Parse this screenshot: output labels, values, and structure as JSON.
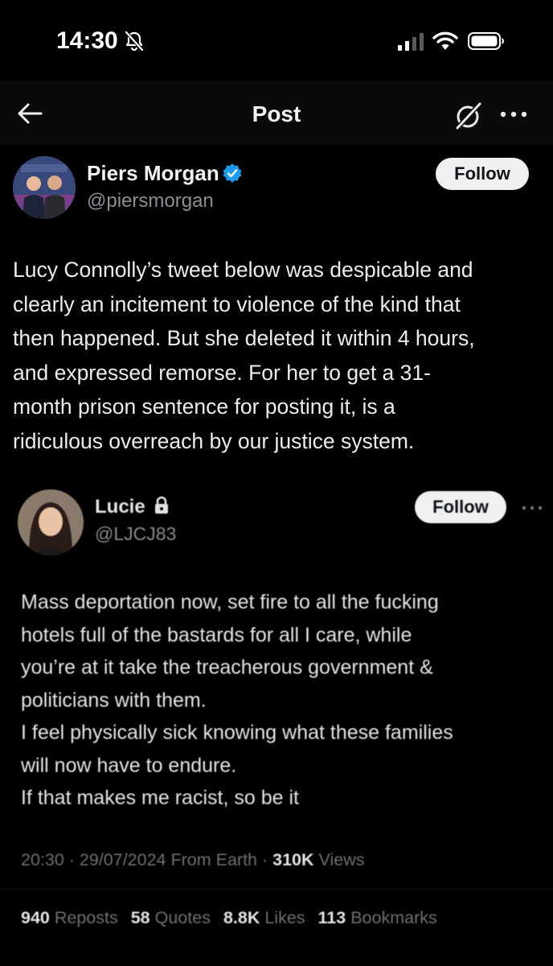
{
  "status_bar": {
    "time": "14:30",
    "icons": [
      "bell-slash-icon",
      "cellular-signal-icon",
      "wifi-icon",
      "battery-icon"
    ]
  },
  "nav": {
    "title": "Post",
    "icons": [
      "back-arrow-icon",
      "grok-icon",
      "more-horizontal-icon"
    ]
  },
  "post": {
    "author_name": "Piers Morgan",
    "author_handle": "@piersmorgan",
    "verified": true,
    "follow_label": "Follow",
    "text": "Lucy Connolly’s tweet below was despicable and\nclearly an incitement to violence of the kind that\nthen happened. But she deleted it within 4 hours,\nand expressed remorse. For her to get a 31-\nmonth prison sentence for posting it, is a\nridiculous overreach by our justice system."
  },
  "quoted": {
    "author_name": "Lucie",
    "author_handle": "@LJCJ83",
    "protected": true,
    "follow_label": "Follow",
    "text": "Mass deportation now, set fire to all the fucking\nhotels full of the bastards for all I care, while\nyou’re at it take the treacherous government &\npoliticians with them.\nI feel physically sick knowing what these families\nwill now have to endure.\nIf that makes me racist, so be it",
    "meta_prefix": "20:30 · 29/07/2024 From Earth · ",
    "views_count": "310K",
    "views_label": " Views",
    "stats": [
      {
        "count": "940",
        "label": "Reposts"
      },
      {
        "count": "58",
        "label": "Quotes"
      },
      {
        "count": "8.8K",
        "label": "Likes"
      },
      {
        "count": "113",
        "label": "Bookmarks"
      }
    ]
  },
  "colors": {
    "background": "#000000",
    "verified_blue": "#1d9bf0",
    "secondary_text": "#8b8f94"
  }
}
